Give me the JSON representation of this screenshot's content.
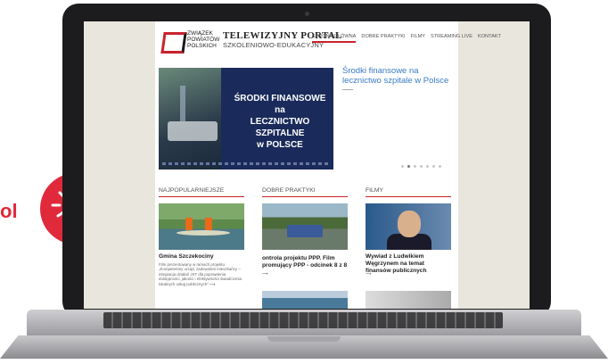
{
  "left_text": "ol",
  "logo": {
    "org_lines": [
      "ZWIĄZEK",
      "POWIATÓW",
      "POLSKICH"
    ],
    "title": "TELEWIZYJNY PORTAL",
    "subtitle": "SZKOLENIOWO-EDUKACYJNY"
  },
  "nav": [
    "STRONA GŁÓWNA",
    "DOBRE PRAKTYKI",
    "FILMY",
    "STREAMING LIVE",
    "KONTAKT"
  ],
  "hero": {
    "lines": [
      "ŚRODKI FINANSOWE",
      "na",
      "LECZNICTWO SZPITALNE",
      "w POLSCE"
    ],
    "side_title": "Środki finansowe na lecznictwo szpitale w Polsce"
  },
  "columns": [
    {
      "heading": "NAJPOPULARNIEJSZE",
      "title": "Gmina Szczekociny",
      "desc": "Film prezentowany w ramach projektu „Kompetentny urząd, zadowoleni mieszkańcy – integracja działań JST dla poprawienia dostępności, jakości i efektywności świadczenia lokalnych usług publicznych”",
      "arrow": "⟶"
    },
    {
      "heading": "DOBRE PRAKTYKI",
      "title": "ontrola projektu PPP. Film promujący PPP - odcinek 8 z 8",
      "desc": "",
      "arrow": "⟶"
    },
    {
      "heading": "FILMY",
      "title": "Wywiad z Ludwikiem Węgrzynem na temat finansów publicznych",
      "desc": "",
      "arrow": "⟶"
    }
  ],
  "colors": {
    "accent": "#c8232c",
    "link": "#3a7cc4",
    "badge": "#e02a3c"
  }
}
